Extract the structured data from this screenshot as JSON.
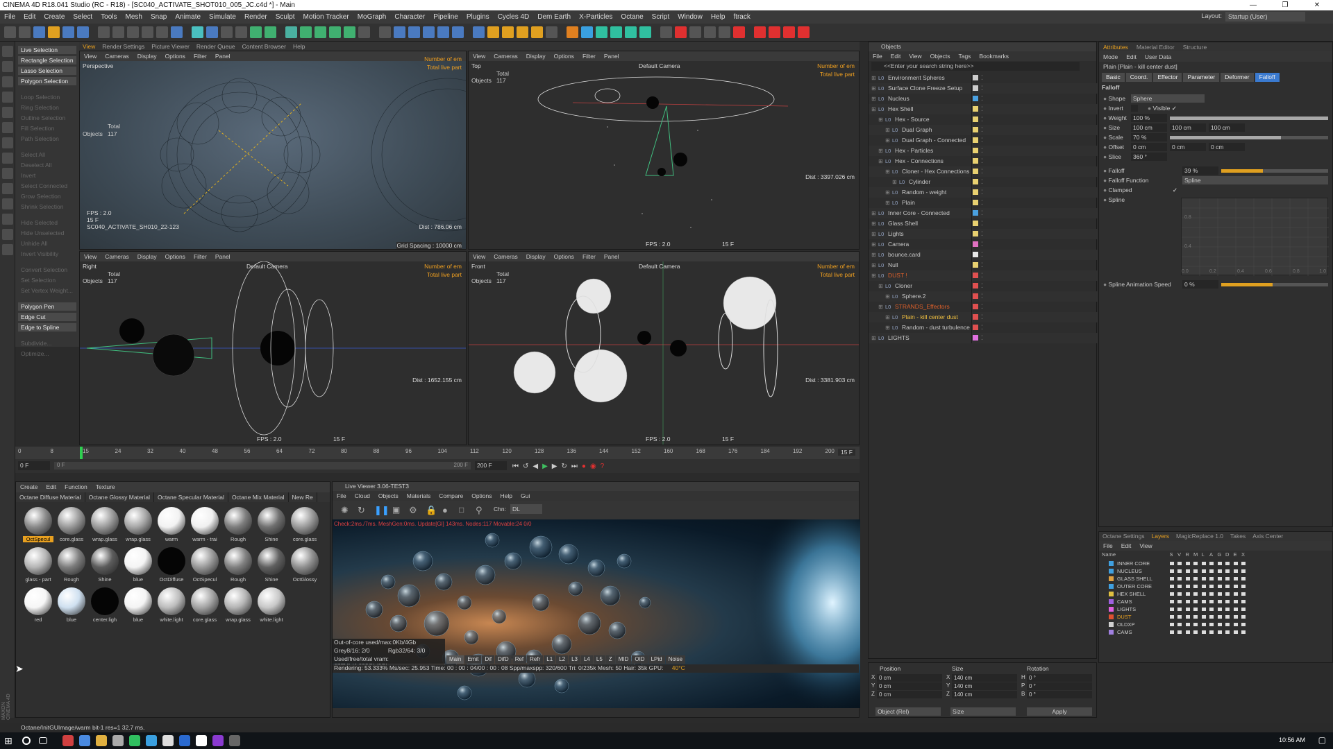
{
  "window": {
    "title": "CINEMA 4D R18.041 Studio (RC - R18) - [SC040_ACTIVATE_SHOT010_005_JC.c4d *] - Main",
    "layout_label": "Layout:",
    "layout_value": "Startup (User)"
  },
  "menubar": [
    "File",
    "Edit",
    "Create",
    "Select",
    "Tools",
    "Mesh",
    "Snap",
    "Animate",
    "Simulate",
    "Render",
    "Sculpt",
    "Motion Tracker",
    "MoGraph",
    "Character",
    "Pipeline",
    "Plugins",
    "Cycles 4D",
    "Dem Earth",
    "X-Particles",
    "Octane",
    "Script",
    "Window",
    "Help",
    "ftrack"
  ],
  "viewport_tabs": [
    "View",
    "Render Settings",
    "Picture Viewer",
    "Render Queue",
    "Content Browser",
    "Help"
  ],
  "selection_menu": {
    "active": [
      "Live Selection",
      "Rectangle Selection",
      "Lasso Selection",
      "Polygon Selection"
    ],
    "disabled_a": [
      "Loop Selection",
      "Ring Selection",
      "Outline Selection",
      "Fill Selection",
      "Path Selection"
    ],
    "disabled_b": [
      "Select All",
      "Deselect All",
      "Invert",
      "Select Connected",
      "Grow Selection",
      "Shrink Selection"
    ],
    "disabled_c": [
      "Hide Selected",
      "Hide Unselected",
      "Unhide All",
      "Invert Visibility"
    ],
    "disabled_d": [
      "Convert Selection",
      "Set Selection",
      "Set Vertex Weight..."
    ],
    "extra": [
      "Polygon Pen",
      "Edge Cut",
      "Edge to Spline"
    ],
    "disabled_e": [
      "Subdivide...",
      "Optimize..."
    ]
  },
  "viewport_menu": [
    "View",
    "Cameras",
    "Display",
    "Options",
    "Filter",
    "Panel"
  ],
  "viewports": {
    "perspective": {
      "name": "Perspective",
      "total": "Total",
      "objects_label": "Objects",
      "objects": "117",
      "orange1": "Number of em",
      "orange2": "Total live part",
      "fps": "FPS : 2.0",
      "frame": "15 F",
      "camname": "SC040_ACTIVATE_SH010_22-123",
      "dist": "Dist : 786.06 cm",
      "grid": "Grid Spacing : 10000 cm"
    },
    "top": {
      "name": "Top",
      "total": "Total",
      "objects_label": "Objects",
      "objects": "117",
      "orange1": "Number of em",
      "orange2": "Total live part",
      "camera": "Default Camera",
      "dist": "Dist : 3397.026 cm",
      "fps": "FPS : 2.0",
      "frame": "15 F"
    },
    "right": {
      "name": "Right",
      "total": "Total",
      "objects_label": "Objects",
      "objects": "117",
      "orange1": "Number of em",
      "orange2": "Total live part",
      "camera": "Default Camera",
      "dist": "Dist : 1652.155 cm",
      "fps": "FPS : 2.0",
      "frame": "15 F"
    },
    "front": {
      "name": "Front",
      "total": "Total",
      "objects_label": "Objects",
      "objects": "117",
      "orange1": "Number of em",
      "orange2": "Total live part",
      "camera": "Default Camera",
      "dist": "Dist : 3381.903 cm",
      "fps": "FPS : 2.0",
      "frame": "15 F"
    }
  },
  "timeline": {
    "ticks": [
      "0",
      "8",
      "15",
      "24",
      "32",
      "40",
      "48",
      "56",
      "64",
      "72",
      "80",
      "88",
      "96",
      "104",
      "112",
      "120",
      "128",
      "136",
      "144",
      "152",
      "160",
      "168",
      "176",
      "184",
      "192",
      "200"
    ],
    "current": "15 F",
    "start": "0 F",
    "start2": "0 F",
    "end": "200 F",
    "end2": "200 F"
  },
  "material_manager": {
    "menu": [
      "Create",
      "Edit",
      "Function",
      "Texture"
    ],
    "tabs": [
      "Octane Diffuse Material",
      "Octane Glossy Material",
      "Octane Specular Material",
      "Octane Mix Material",
      "New Re"
    ],
    "materials": [
      {
        "label": "OctSpecul",
        "color": "#8a8a8a",
        "sel": true
      },
      {
        "label": "core.glass",
        "color": "#9a9a9a"
      },
      {
        "label": "wrap.glass",
        "color": "#9c9c9c"
      },
      {
        "label": "wrap.glass",
        "color": "#a6a6a6"
      },
      {
        "label": "warm",
        "color": "#f2f2f2"
      },
      {
        "label": "warm - trai",
        "color": "#f0f0f0"
      },
      {
        "label": "Rough",
        "color": "#7d7d7d"
      },
      {
        "label": "Shine",
        "color": "#707070"
      },
      {
        "label": "core.glass",
        "color": "#9b9b9b"
      },
      {
        "label": "glass - part",
        "color": "#b5b5b5"
      },
      {
        "label": "Rough",
        "color": "#7d7d7d"
      },
      {
        "label": "Shine",
        "color": "#5c5c5c"
      },
      {
        "label": "blue",
        "color": "#f4f4f4"
      },
      {
        "label": "OctDiffuse",
        "color": "#050505"
      },
      {
        "label": "OctSpecul",
        "color": "#9a9a9a"
      },
      {
        "label": "Rough",
        "color": "#808080"
      },
      {
        "label": "Shine",
        "color": "#606060"
      },
      {
        "label": "OctGlossy",
        "color": "#909090"
      },
      {
        "label": "red",
        "color": "#f6f6f6"
      },
      {
        "label": "blue",
        "color": "#cfe0f0"
      },
      {
        "label": "center.ligh",
        "color": "#050505"
      },
      {
        "label": "blue",
        "color": "#f4f4f4"
      },
      {
        "label": "white.light",
        "color": "#bdbdbd"
      },
      {
        "label": "core.glass",
        "color": "#a5a5a5"
      },
      {
        "label": "wrap.glass",
        "color": "#b4b4b4"
      },
      {
        "label": "white.light",
        "color": "#c8c8c8"
      }
    ]
  },
  "live_viewer": {
    "title": "Live Viewer 3.06-TEST3",
    "menu": [
      "File",
      "Cloud",
      "Objects",
      "Materials",
      "Compare",
      "Options",
      "Help",
      "Gui"
    ],
    "chn_label": "Chn:",
    "chn_value": "DL",
    "status_red": "Check:2ms./7ms. MeshGen:0ms. Update[Gl] 143ms. Nodes:117 Movable:24 0/0",
    "outofcore": "Out-of-core used/max:0Kb/4Gb",
    "grey": "Grey8/16: 2/0",
    "rgb": "Rgb32/64: 3/0",
    "vram": "Used/free/total vram: 677Mb/4.092Gb/6Gb",
    "passes": [
      "Main",
      "Emit",
      "Dif",
      "DifD",
      "Ref",
      "Refr",
      "L1",
      "L2",
      "L3",
      "L4",
      "L5",
      "Z",
      "MID",
      "OID",
      "LPid",
      "Noise"
    ],
    "rendering": "Rendering: 53.333%  Ms/sec: 25.953   Time: 00 : 00 : 04/00 : 00 : 08  Spp/maxspp: 320/600   Tri: 0/235k  Mesh: 50   Hair: 35k   GPU:",
    "gpu_temp": "40°C"
  },
  "object_manager": {
    "header": "Objects",
    "menu": [
      "File",
      "Edit",
      "View",
      "Objects",
      "Tags",
      "Bookmarks"
    ],
    "search": "<<Enter your search string here>>",
    "rows": [
      {
        "name": "Environment Spheres",
        "indent": 0,
        "color": "#c8c8c8",
        "tagc": "#cccccc"
      },
      {
        "name": "Surface Clone Freeze Setup",
        "indent": 0,
        "color": "#c8c8c8",
        "tagc": "#cccccc"
      },
      {
        "name": "Nucleus",
        "indent": 0,
        "color": "#c8c8c8",
        "tagc": "#4aa0e0"
      },
      {
        "name": "Hex Shell",
        "indent": 0,
        "color": "#c8c8c8",
        "tagc": "#e8d070"
      },
      {
        "name": "Hex - Source",
        "indent": 1,
        "color": "#c8c8c8",
        "tagc": "#e8d070"
      },
      {
        "name": "Dual Graph",
        "indent": 2,
        "color": "#c8c8c8",
        "tagc": "#e8d070"
      },
      {
        "name": "Dual Graph - Connected",
        "indent": 2,
        "color": "#c8c8c8",
        "tagc": "#e8d070"
      },
      {
        "name": "Hex - Particles",
        "indent": 1,
        "color": "#c8c8c8",
        "tagc": "#e8d070"
      },
      {
        "name": "Hex - Connections",
        "indent": 1,
        "color": "#c8c8c8",
        "tagc": "#e8d070"
      },
      {
        "name": "Cloner - Hex Connections",
        "indent": 2,
        "color": "#c8c8c8",
        "tagc": "#e8d070"
      },
      {
        "name": "Cylinder",
        "indent": 3,
        "color": "#c8c8c8",
        "tagc": "#e8d070"
      },
      {
        "name": "Random - weight",
        "indent": 2,
        "color": "#c8c8c8",
        "tagc": "#e8d070"
      },
      {
        "name": "Plain",
        "indent": 2,
        "color": "#c8c8c8",
        "tagc": "#e8d070"
      },
      {
        "name": "Inner Core - Connected",
        "indent": 0,
        "color": "#c8c8c8",
        "tagc": "#4aa0e0"
      },
      {
        "name": "Glass Shell",
        "indent": 0,
        "color": "#c8c8c8",
        "tagc": "#e8d070"
      },
      {
        "name": "Lights",
        "indent": 0,
        "color": "#c8c8c8",
        "tagc": "#e8d070"
      },
      {
        "name": "Camera",
        "indent": 0,
        "color": "#c8c8c8",
        "tagc": "#e070c0"
      },
      {
        "name": "bounce.card",
        "indent": 0,
        "color": "#c8c8c8",
        "tagc": "#e8e8e8"
      },
      {
        "name": "Null",
        "indent": 0,
        "color": "#c8c8c8",
        "tagc": "#e8d070"
      },
      {
        "name": "DUST !",
        "indent": 0,
        "color": "#e0602a",
        "tagc": "#e05050"
      },
      {
        "name": "Cloner",
        "indent": 1,
        "color": "#c8c8c8",
        "tagc": "#e05050"
      },
      {
        "name": "Sphere.2",
        "indent": 2,
        "color": "#c8c8c8",
        "tagc": "#e05050"
      },
      {
        "name": "STRANDS_Effectors",
        "indent": 1,
        "color": "#e0602a",
        "tagc": "#e05050"
      },
      {
        "name": "Plain - kill center dust",
        "indent": 2,
        "color": "#f0c040",
        "tagc": "#e05050"
      },
      {
        "name": "Random - dust turbulence",
        "indent": 2,
        "color": "#c8c8c8",
        "tagc": "#e05050"
      },
      {
        "name": "LIGHTS",
        "indent": 0,
        "color": "#c8c8c8",
        "tagc": "#e070e0"
      }
    ]
  },
  "attributes": {
    "tabs_top": [
      "Attributes",
      "Material Editor",
      "Structure"
    ],
    "menu": [
      "Mode",
      "Edit",
      "User Data"
    ],
    "object_label": "Plain [Plain - kill center dust]",
    "tabs": [
      "Basic",
      "Coord.",
      "Effector",
      "Parameter",
      "Deformer",
      "Falloff"
    ],
    "active_tab": "Falloff",
    "section": "Falloff",
    "shape_label": "Shape",
    "shape_value": "Sphere",
    "invert_label": "Invert",
    "visible_label": "Visible",
    "weight_label": "Weight",
    "weight_value": "100 %",
    "size_label": "Size",
    "size_values": [
      "100 cm",
      "100 cm",
      "100 cm"
    ],
    "scale_label": "Scale",
    "scale_value": "70 %",
    "offset_label": "Offset",
    "offset_values": [
      "0 cm",
      "0 cm",
      "0 cm"
    ],
    "slice_label": "Slice",
    "slice_value": "360 °",
    "falloff_label": "Falloff",
    "falloff_value": "39 %",
    "falloff_function_label": "Falloff Function",
    "falloff_function_value": "Spline",
    "clamped_label": "Clamped",
    "spline_label": "Spline",
    "graph_y": [
      "0.8",
      "0.4"
    ],
    "graph_x": [
      "0.0",
      "0.2",
      "0.4",
      "0.6",
      "0.8",
      "1.0"
    ],
    "spline_speed_label": "Spline Animation Speed",
    "spline_speed_value": "0 %"
  },
  "layer_manager": {
    "tabs": [
      "Octane Settings",
      "Layers",
      "MagicReplace 1.0",
      "Takes",
      "Axis Center"
    ],
    "active_tab": "Layers",
    "menu": [
      "File",
      "Edit",
      "View"
    ],
    "columns": [
      "Name",
      "S",
      "V",
      "R",
      "M",
      "L",
      "A",
      "G",
      "D",
      "E",
      "X"
    ],
    "layers": [
      {
        "name": "INNER CORE",
        "color": "#40a0e0"
      },
      {
        "name": "NUCLEUS",
        "color": "#40a0e0"
      },
      {
        "name": "GLASS SHELL",
        "color": "#e0a040"
      },
      {
        "name": "OUTER CORE",
        "color": "#40a0e0"
      },
      {
        "name": "HEX SHELL",
        "color": "#e0c040"
      },
      {
        "name": "CAMS",
        "color": "#a060e0"
      },
      {
        "name": "LIGHTS",
        "color": "#e060e0"
      },
      {
        "name": "DUST",
        "color": "#e05030",
        "highlight": true
      },
      {
        "name": "OLDXP",
        "color": "#d0d0d0"
      },
      {
        "name": "CAMS",
        "color": "#a080e0"
      }
    ]
  },
  "coordinates": {
    "headers": [
      "Position",
      "Size",
      "Rotation"
    ],
    "rows": [
      {
        "axis": "X",
        "pos": "0 cm",
        "sizeaxis": "X",
        "size": "140 cm",
        "rotaxis": "H",
        "rot": "0 °"
      },
      {
        "axis": "Y",
        "pos": "0 cm",
        "sizeaxis": "Y",
        "size": "140 cm",
        "rotaxis": "P",
        "rot": "0 °"
      },
      {
        "axis": "Z",
        "pos": "0 cm",
        "sizeaxis": "Z",
        "size": "140 cm",
        "rotaxis": "B",
        "rot": "0 °"
      }
    ],
    "mode": "Object (Rel)",
    "size_mode": "Size",
    "apply": "Apply"
  },
  "statusbar": "Octane/InitGUImage/warm bit-1 res=1 32.7 ms.",
  "taskbar": {
    "time": "10:56 AM"
  },
  "maxon_label": "MAXON CINEMA 4D"
}
